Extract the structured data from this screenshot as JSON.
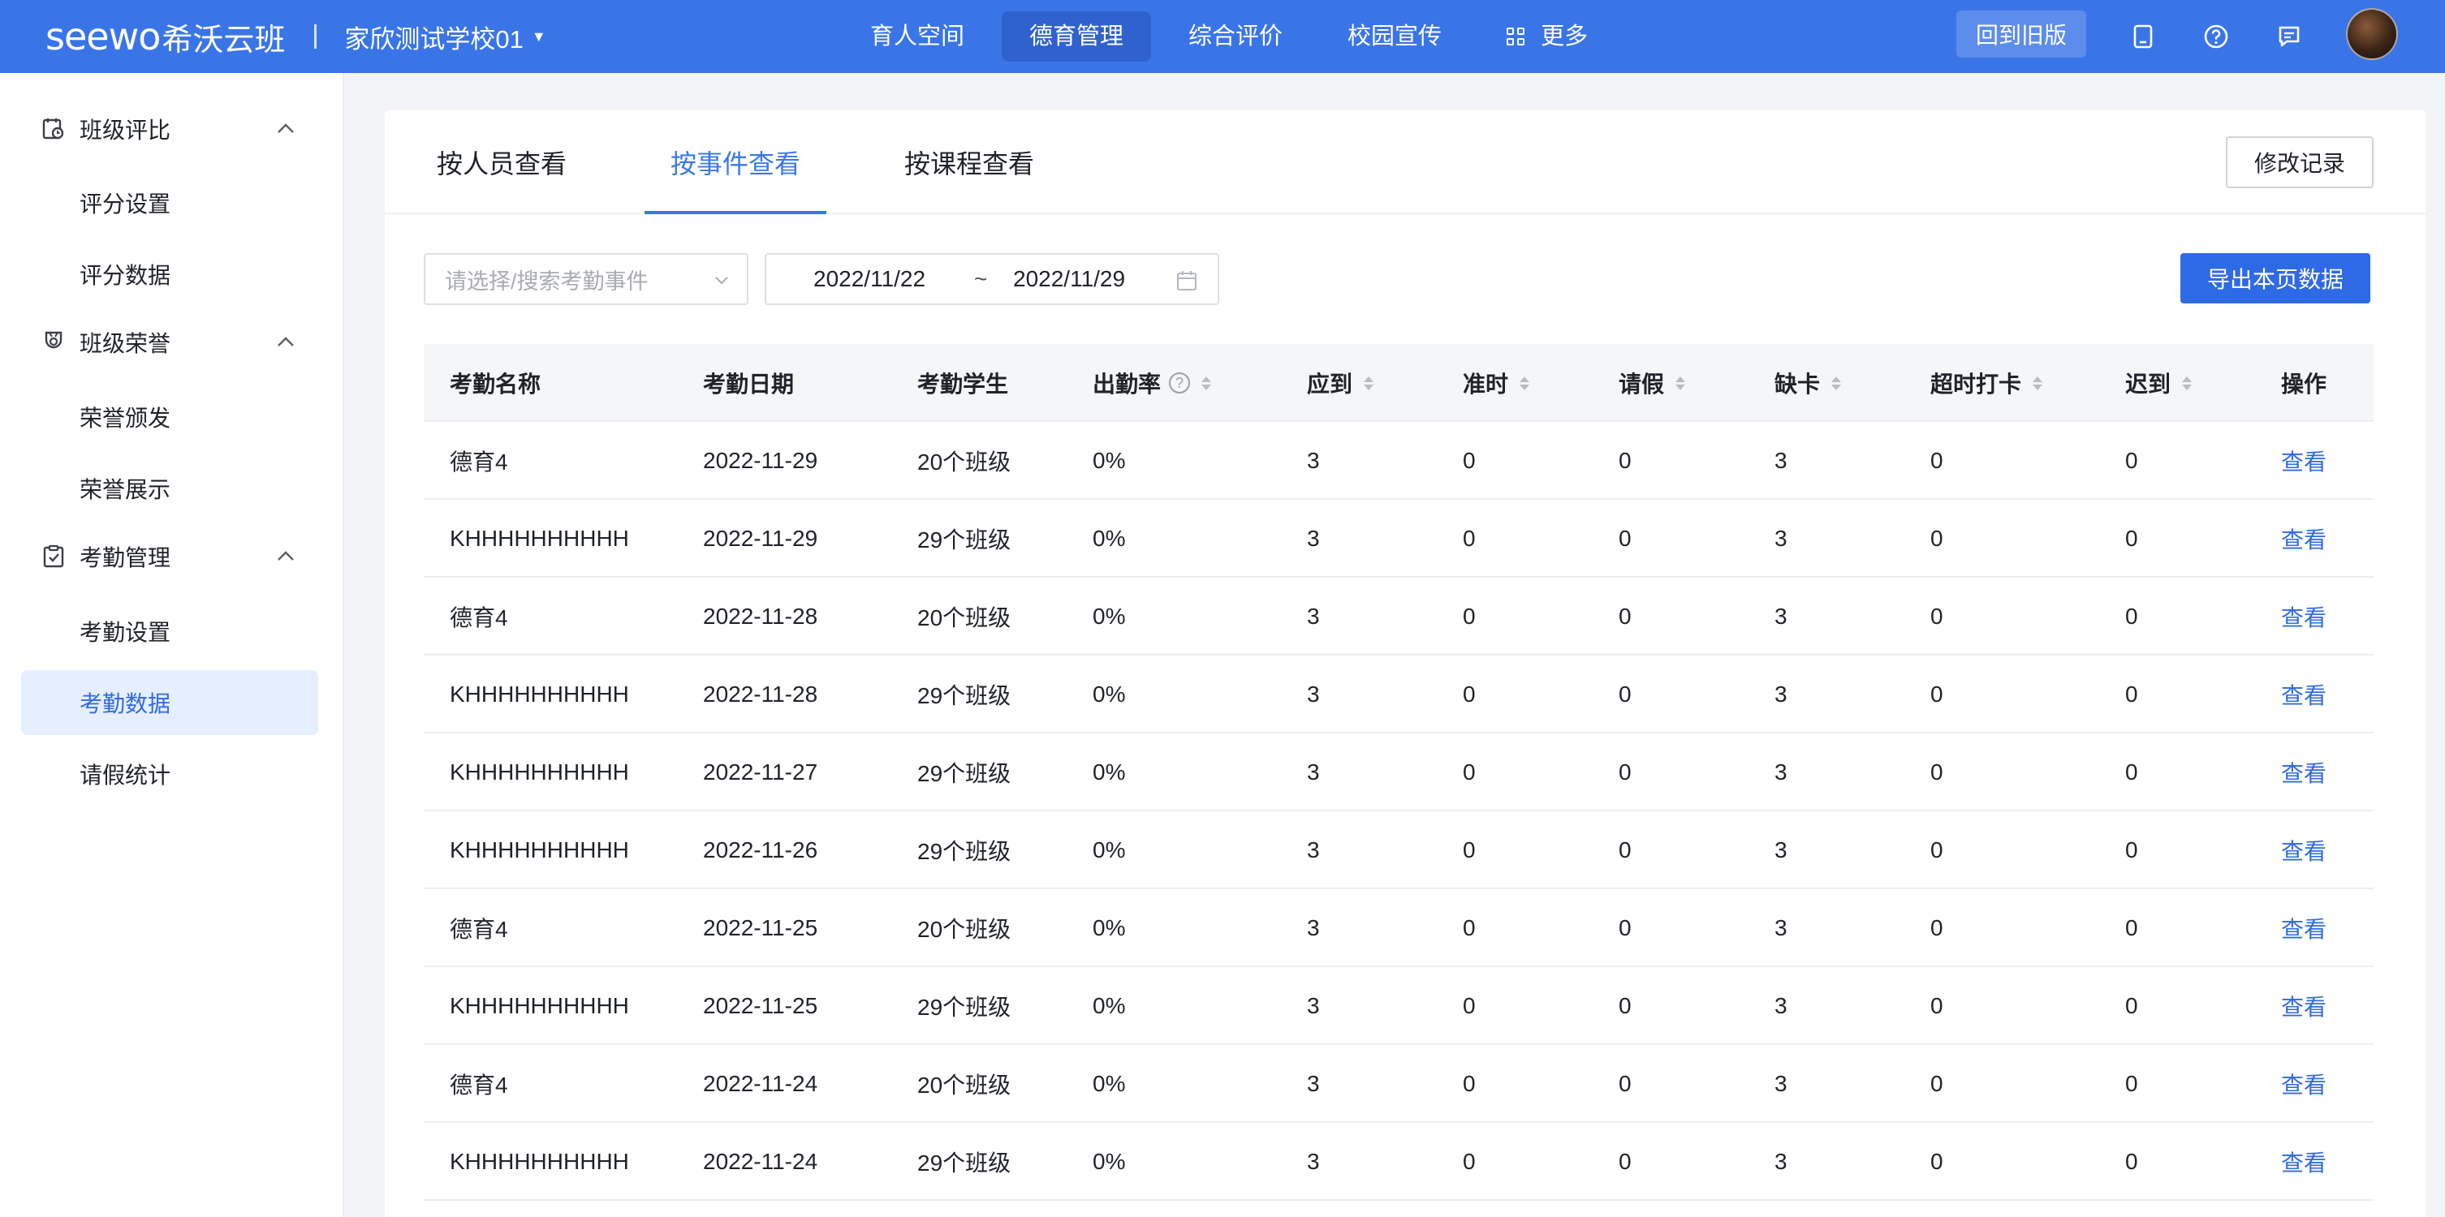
{
  "header": {
    "brand_logo": "seewo",
    "brand_name": "希沃云班",
    "school": "家欣测试学校01",
    "nav": [
      {
        "label": "育人空间"
      },
      {
        "label": "德育管理"
      },
      {
        "label": "综合评价"
      },
      {
        "label": "校园宣传"
      },
      {
        "label": "更多"
      }
    ],
    "active_nav_index": 1,
    "old_version_label": "回到旧版"
  },
  "sidebar": {
    "groups": [
      {
        "label": "班级评比",
        "icon": "class-rating-icon",
        "items": [
          {
            "label": "评分设置"
          },
          {
            "label": "评分数据"
          }
        ]
      },
      {
        "label": "班级荣誉",
        "icon": "medal-icon",
        "items": [
          {
            "label": "荣誉颁发"
          },
          {
            "label": "荣誉展示"
          }
        ]
      },
      {
        "label": "考勤管理",
        "icon": "clipboard-check-icon",
        "items": [
          {
            "label": "考勤设置"
          },
          {
            "label": "考勤数据"
          },
          {
            "label": "请假统计"
          }
        ]
      }
    ],
    "active_item": "考勤数据"
  },
  "tabs": [
    {
      "label": "按人员查看"
    },
    {
      "label": "按事件查看"
    },
    {
      "label": "按课程查看"
    }
  ],
  "active_tab_index": 1,
  "modify_record_label": "修改记录",
  "filters": {
    "event_placeholder": "请选择/搜索考勤事件",
    "date_start": "2022/11/22",
    "date_separator": "~",
    "date_end": "2022/11/29"
  },
  "export_label": "导出本页数据",
  "table": {
    "columns": [
      "考勤名称",
      "考勤日期",
      "考勤学生",
      "出勤率",
      "应到",
      "准时",
      "请假",
      "缺卡",
      "超时打卡",
      "迟到",
      "操作"
    ],
    "rows": [
      [
        "德育4",
        "2022-11-29",
        "20个班级",
        "0%",
        "3",
        "0",
        "0",
        "3",
        "0",
        "0",
        "查看"
      ],
      [
        "KHHHHHHHHHH",
        "2022-11-29",
        "29个班级",
        "0%",
        "3",
        "0",
        "0",
        "3",
        "0",
        "0",
        "查看"
      ],
      [
        "德育4",
        "2022-11-28",
        "20个班级",
        "0%",
        "3",
        "0",
        "0",
        "3",
        "0",
        "0",
        "查看"
      ],
      [
        "KHHHHHHHHHH",
        "2022-11-28",
        "29个班级",
        "0%",
        "3",
        "0",
        "0",
        "3",
        "0",
        "0",
        "查看"
      ],
      [
        "KHHHHHHHHHH",
        "2022-11-27",
        "29个班级",
        "0%",
        "3",
        "0",
        "0",
        "3",
        "0",
        "0",
        "查看"
      ],
      [
        "KHHHHHHHHHH",
        "2022-11-26",
        "29个班级",
        "0%",
        "3",
        "0",
        "0",
        "3",
        "0",
        "0",
        "查看"
      ],
      [
        "德育4",
        "2022-11-25",
        "20个班级",
        "0%",
        "3",
        "0",
        "0",
        "3",
        "0",
        "0",
        "查看"
      ],
      [
        "KHHHHHHHHHH",
        "2022-11-25",
        "29个班级",
        "0%",
        "3",
        "0",
        "0",
        "3",
        "0",
        "0",
        "查看"
      ],
      [
        "德育4",
        "2022-11-24",
        "20个班级",
        "0%",
        "3",
        "0",
        "0",
        "3",
        "0",
        "0",
        "查看"
      ],
      [
        "KHHHHHHHHHH",
        "2022-11-24",
        "29个班级",
        "0%",
        "3",
        "0",
        "0",
        "3",
        "0",
        "0",
        "查看"
      ]
    ]
  },
  "colors": {
    "primary": "#3a75e8",
    "link": "#2f6ae6",
    "active_menu_bg": "#e6efff"
  }
}
